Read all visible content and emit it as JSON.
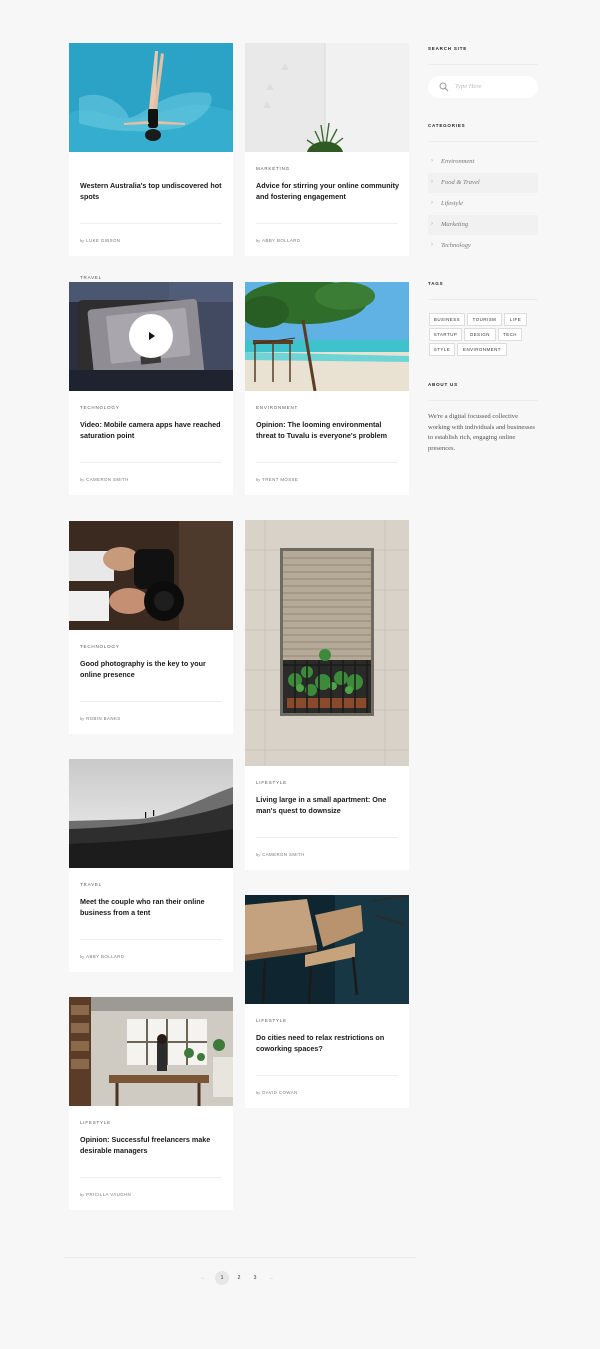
{
  "cards": [
    {
      "category": "Travel",
      "title": "Western Australia's top undiscovered hot spots",
      "by": "by",
      "author": "Luke Gibson"
    },
    {
      "category": "Marketing",
      "title": "Advice for stirring your online community and fostering engagement",
      "by": "by",
      "author": "Abby Bollard"
    },
    {
      "category": "Technology",
      "title": "Video: Mobile camera apps have reached saturation point",
      "by": "by",
      "author": "Cameron Smith"
    },
    {
      "category": "Environment",
      "title": "Opinion: The looming environmental threat to Tuvalu is everyone's problem",
      "by": "by",
      "author": "Trent Mosse"
    },
    {
      "category": "Technology",
      "title": "Good photography is the key to your online presence",
      "by": "by",
      "author": "Robin Banks"
    },
    {
      "category": "Lifestyle",
      "title": "Living large in a small apartment: One man's quest to downsize",
      "by": "by",
      "author": "Cameron Smith"
    },
    {
      "category": "Travel",
      "title": "Meet the couple who ran their online business from a tent",
      "by": "by",
      "author": "Abby Bollard"
    },
    {
      "category": "Lifestyle",
      "title": "Do cities need to relax restrictions on coworking spaces?",
      "by": "by",
      "author": "David Cowan"
    },
    {
      "category": "Lifestyle",
      "title": "Opinion: Successful freelancers make desirable managers",
      "by": "by",
      "author": "Pricilla Vaughn"
    }
  ],
  "sidebar": {
    "search_heading": "Search Site",
    "search_placeholder": "Type Here",
    "categories_heading": "Categories",
    "categories": [
      "Environment",
      "Food & Travel",
      "Lifestyle",
      "Marketing",
      "Technology"
    ],
    "tags_heading": "Tags",
    "tags": [
      "Business",
      "Tourism",
      "Life",
      "Startup",
      "Design",
      "Tech",
      "Style",
      "Environment"
    ],
    "about_heading": "About Us",
    "about_text": "We're a digital focussed collective working with individuals and businesses to establish rich, engaging online presences."
  },
  "pagination": {
    "prev": "←",
    "pages": [
      "1",
      "2",
      "3"
    ],
    "next": "→",
    "current": "1"
  },
  "colors": {
    "background": "#f7f7f7",
    "card": "#ffffff",
    "pool": "#2aa3c6",
    "sea": "#3fc4cf"
  }
}
